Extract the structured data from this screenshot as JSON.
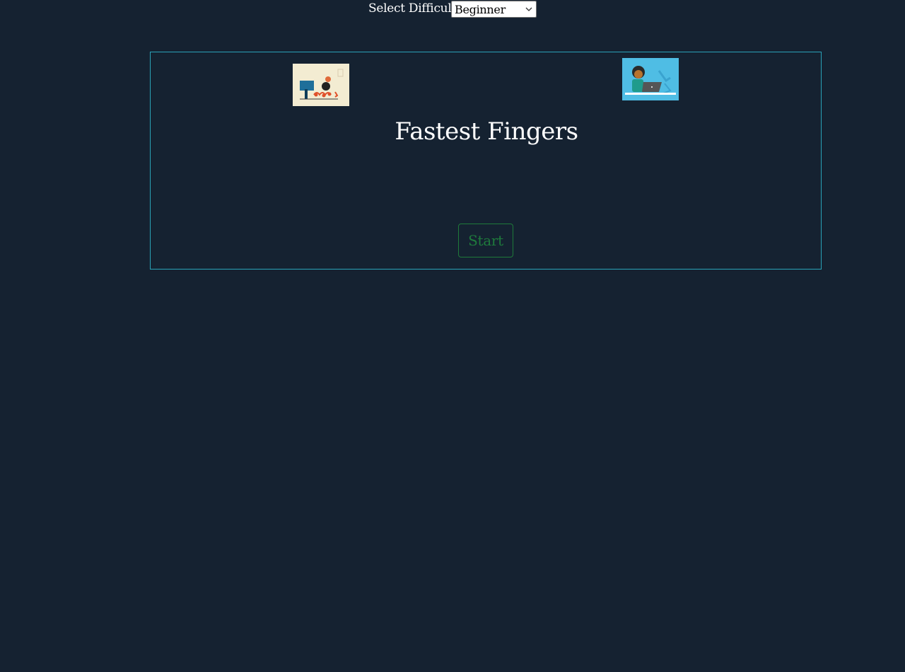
{
  "header": {
    "difficulty_label": "Select Difficulty",
    "difficulty_selected": "Beginner"
  },
  "game": {
    "title": "Fastest Fingers",
    "start_label": "Start"
  },
  "colors": {
    "background": "#152231",
    "panel_border": "#2aa3b8",
    "start_text": "#1e7a3c",
    "start_border": "#1f7a3a"
  },
  "icons": {
    "difficulty_select": "chevron-down-icon",
    "left_illustration": "person-at-desk-illustration",
    "right_illustration": "person-with-laptop-illustration"
  }
}
